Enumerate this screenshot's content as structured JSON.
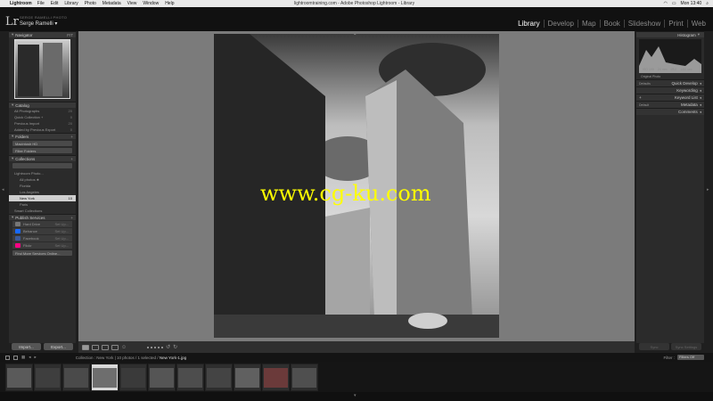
{
  "menubar": {
    "app": "Lightroom",
    "items": [
      "File",
      "Edit",
      "Library",
      "Photo",
      "Metadata",
      "View",
      "Window",
      "Help"
    ],
    "window_title": "lightroomtraining.com - Adobe Photoshop Lightroom - Library",
    "clock": "Mon 13:40"
  },
  "identity": {
    "logo": "Lr",
    "subtitle": "SERGE RAMELLI PHOTO",
    "owner": "Serge Ramelli"
  },
  "modules": [
    "Library",
    "Develop",
    "Map",
    "Book",
    "Slideshow",
    "Print",
    "Web"
  ],
  "active_module": "Library",
  "left_panel": {
    "navigator": {
      "title": "Navigator",
      "zoom": "FIT"
    },
    "catalog": {
      "title": "Catalog",
      "items": [
        {
          "label": "All Photographs",
          "count": "20"
        },
        {
          "label": "Quick Collection +",
          "count": "0"
        },
        {
          "label": "Previous Import",
          "count": "20"
        },
        {
          "label": "Added by Previous Export",
          "count": "0"
        }
      ]
    },
    "folders": {
      "title": "Folders",
      "volume": "Macintosh HD"
    },
    "filter_field": "Filter Folders",
    "collections": {
      "title": "Collections",
      "items": [
        {
          "label": "Lightroom Photo...",
          "count": ""
        },
        {
          "label": "All photos ★",
          "count": ""
        },
        {
          "label": "Florida",
          "count": ""
        },
        {
          "label": "Los Angeles",
          "count": ""
        },
        {
          "label": "New York",
          "count": "10"
        },
        {
          "label": "Paris",
          "count": ""
        },
        {
          "label": "Smart Collections",
          "count": ""
        }
      ],
      "selected_index": 4
    },
    "publish": {
      "title": "Publish Services",
      "services": [
        {
          "label": "Hard Drive",
          "action": "Set Up..."
        },
        {
          "label": "Behance",
          "action": "Set Up..."
        },
        {
          "label": "Facebook",
          "action": "Set Up..."
        },
        {
          "label": "Flickr",
          "action": "Set Up..."
        }
      ],
      "find_more": "Find More Services Online..."
    },
    "buttons": {
      "import": "Import...",
      "export": "Export..."
    }
  },
  "right_panel": {
    "histogram": {
      "title": "Histogram",
      "labels": [
        "ISO 100",
        "24 mm",
        "f/8.0",
        "1/60 sec"
      ],
      "original": "Original Photo"
    },
    "sections": [
      {
        "left": "Defaults",
        "title": "Quick Develop"
      },
      {
        "left": "",
        "title": "Keywording"
      },
      {
        "left": "",
        "title": "Keyword List"
      },
      {
        "left": "Default",
        "title": "Metadata"
      },
      {
        "left": "",
        "title": "Comments"
      }
    ],
    "buttons": {
      "sync": "Sync",
      "sync_settings": "Sync Settings"
    }
  },
  "watermark": "www.cg-ku.com",
  "filmstrip": {
    "source": "Collection : New York",
    "info": "10 photos / 1 selected",
    "filename": "New York-1.jpg",
    "filter_label": "Filter :",
    "filter_value": "Filters Off",
    "thumb_count": 11,
    "selected_index": 3,
    "thumb_tones": [
      "#5a5a5a",
      "#3e3e3e",
      "#4a4a4a",
      "#6e6e6e",
      "#3a3a3a",
      "#555555",
      "#4d4d4d",
      "#444444",
      "#606060",
      "#6b3a3a",
      "#4f4f4f"
    ]
  }
}
